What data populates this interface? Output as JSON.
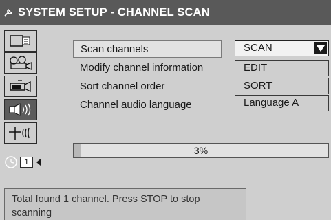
{
  "header": {
    "title": "SYSTEM SETUP - CHANNEL SCAN",
    "icon": "wrench-icon"
  },
  "sidebar": {
    "icons": [
      {
        "name": "display-settings-icon",
        "active": false
      },
      {
        "name": "film-reel-icon",
        "active": false
      },
      {
        "name": "camcorder-icon",
        "active": false
      },
      {
        "name": "speaker-icon",
        "active": true
      },
      {
        "name": "antenna-signal-icon",
        "active": false
      }
    ],
    "page_icon": "clock-icon",
    "page_number": "1",
    "page_arrow": "arrow-left-icon"
  },
  "menu": {
    "items": [
      {
        "label": "Scan channels",
        "value": "SCAN",
        "selected": true,
        "has_dropdown": true
      },
      {
        "label": "Modify channel information",
        "value": "EDIT",
        "selected": false
      },
      {
        "label": "Sort channel order",
        "value": "SORT",
        "selected": false
      },
      {
        "label": "Channel audio language",
        "value": "Language A",
        "selected": false
      }
    ]
  },
  "progress": {
    "percent": 3,
    "label": "3%"
  },
  "status": {
    "message": "Total found 1 channel. Press STOP to stop scanning"
  },
  "colors": {
    "title_bar": "#595959",
    "background": "#cfcfcf",
    "selected_row": "#e2e2e2"
  }
}
